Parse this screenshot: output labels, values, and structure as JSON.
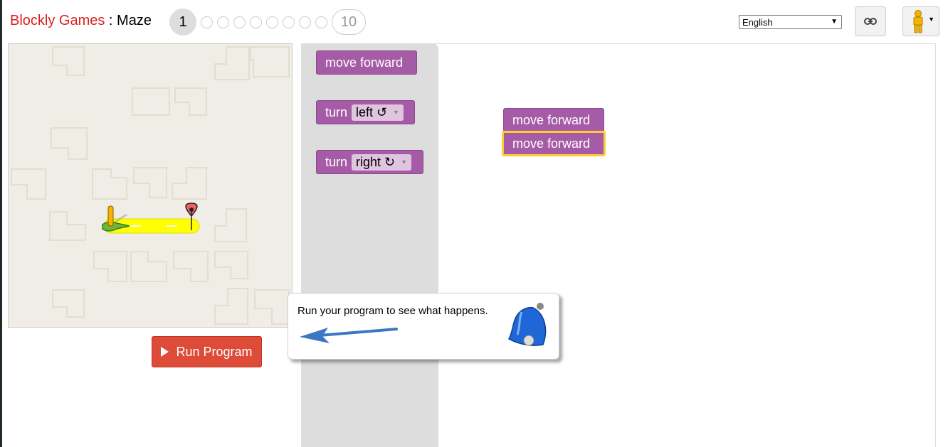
{
  "header": {
    "app_name": "Blockly Games",
    "separator": " : ",
    "game_name": "Maze",
    "levels": {
      "current": "1",
      "last": "10",
      "intermediate_count": 8
    }
  },
  "language": {
    "selected": "English"
  },
  "icons": {
    "link": "link-icon",
    "pegman": "pegman-icon",
    "bell": "bell-icon",
    "play": "play-icon"
  },
  "run_button": {
    "label": "Run Program"
  },
  "toolbox": {
    "blocks": [
      {
        "label": "move forward"
      },
      {
        "label": "turn",
        "option": "left ↺"
      },
      {
        "label": "turn",
        "option": "right ↻"
      }
    ]
  },
  "workspace": {
    "blocks": [
      {
        "label": "move forward"
      },
      {
        "label": "move forward"
      }
    ]
  },
  "tooltip": {
    "text": "Run your program to see what happens."
  },
  "colors": {
    "block": "#a55ba5",
    "run_button": "#dd4b39",
    "path": "#ffff00",
    "title_red": "#dd1f1f"
  }
}
